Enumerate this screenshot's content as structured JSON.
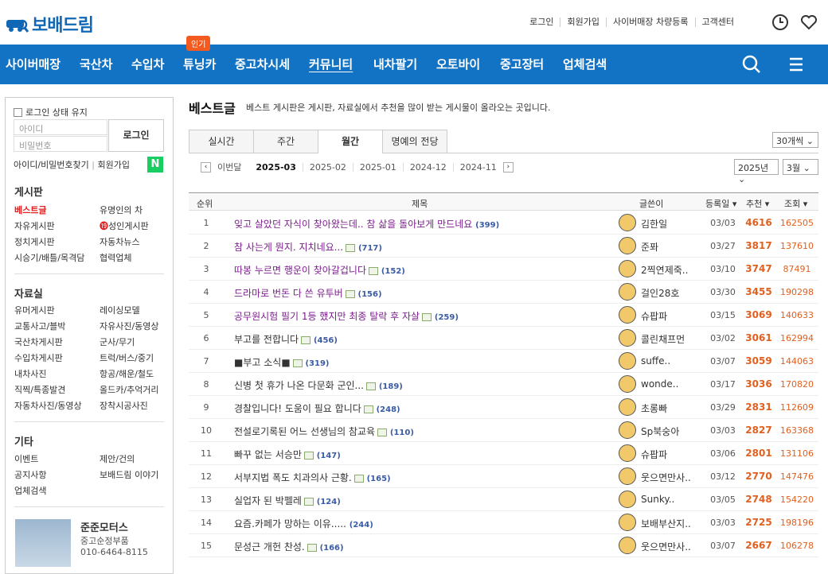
{
  "brand": {
    "logo_text": "보배드림",
    "accent": "#1273c4",
    "badge_color": "#f25a1f"
  },
  "top_links": [
    "로그인",
    "회원가입",
    "사이버매장 차량등록",
    "고객센터"
  ],
  "top_icons": [
    "clock-icon",
    "heart-icon"
  ],
  "nav": {
    "items": [
      "사이버매장",
      "국산차",
      "수입차",
      "튜닝카",
      "중고차시세",
      "커뮤니티",
      "내차팔기",
      "오토바이",
      "중고장터",
      "업체검색"
    ],
    "active": "커뮤니티",
    "hot_badge": "인기"
  },
  "sidebar": {
    "keep_login": "로그인 상태 유지",
    "id_placeholder": "아이디",
    "pw_placeholder": "비밀번호",
    "login_button": "로그인",
    "find_link": "아이디/비밀번호찾기",
    "join_link": "회원가입",
    "naver_label": "N",
    "sections": [
      {
        "title": "게시판",
        "items": [
          "베스트글",
          "유명인의 차",
          "자유게시판",
          "성인게시판",
          "정치게시판",
          "자동차뉴스",
          "시승기/배틀/목격담",
          "협력업체"
        ]
      },
      {
        "title": "자료실",
        "items": [
          "유머게시판",
          "레이싱모델",
          "교통사고/블박",
          "자유사진/동영상",
          "국산차게시판",
          "군사/무기",
          "수입차게시판",
          "트럭/버스/중기",
          "내차사진",
          "항공/해운/철도",
          "직찍/특종발견",
          "올드카/추억거리",
          "자동차사진/동영상",
          "장착시공사진"
        ]
      },
      {
        "title": "기타",
        "items": [
          "이벤트",
          "제안/건의",
          "공지사항",
          "보배드림 이야기",
          "업체검색"
        ]
      }
    ],
    "banner": {
      "title": "준준모터스",
      "sub": "중고순정부품",
      "phone": "010-6464-8115"
    }
  },
  "main": {
    "title": "베스트글",
    "desc": "베스트 게시판은 게시판, 자료실에서 추천을 많이 받는 게시물이 올라오는 곳입니다.",
    "tabs": [
      "실시간",
      "주간",
      "월간",
      "명예의 전당"
    ],
    "active_tab": "월간",
    "per_page": "30개씩",
    "prev_label": "이번달",
    "months": [
      "2025-03",
      "2025-02",
      "2025-01",
      "2024-12",
      "2024-11"
    ],
    "year_select": "2025년",
    "month_select": "3월",
    "columns": [
      "순위",
      "제목",
      "글쓴이",
      "등록일",
      "추천",
      "조회"
    ]
  },
  "posts": [
    {
      "no": "1",
      "title": "잊고 살았던 자식이 찾아왔는데.. 참 삶을 돌아보게 만드네요",
      "img": false,
      "cmt": "(399)",
      "writer": "김한일",
      "date": "03/03",
      "rec": "4616",
      "views": "162505",
      "visited": true
    },
    {
      "no": "2",
      "title": "참 사는게 뭔지. 지치네요...",
      "img": true,
      "cmt": "(717)",
      "writer": "준퐈",
      "date": "03/27",
      "rec": "3817",
      "views": "137610",
      "visited": true
    },
    {
      "no": "3",
      "title": "따봉 누르면 행운이 찾아갈겁니다",
      "img": true,
      "cmt": "(152)",
      "writer": "2찍연제죽..",
      "date": "03/10",
      "rec": "3747",
      "views": "87491",
      "visited": true
    },
    {
      "no": "4",
      "title": "드라마로 번돈 다 쓴 유투버",
      "img": true,
      "cmt": "(156)",
      "writer": "걸인28호",
      "date": "03/30",
      "rec": "3455",
      "views": "190298",
      "visited": true
    },
    {
      "no": "5",
      "title": "공무원시험 필기 1등 했지만 최종 탈락 후 자살",
      "img": true,
      "cmt": "(259)",
      "writer": "슈팝파",
      "date": "03/15",
      "rec": "3069",
      "views": "140633",
      "visited": true
    },
    {
      "no": "6",
      "title": "부고를 전합니다",
      "img": true,
      "cmt": "(456)",
      "writer": "콜린채프먼",
      "date": "03/02",
      "rec": "3061",
      "views": "162994",
      "visited": false
    },
    {
      "no": "7",
      "title": "■부고 소식■",
      "img": true,
      "cmt": "(319)",
      "writer": "suffe..",
      "date": "03/07",
      "rec": "3059",
      "views": "144063",
      "visited": false
    },
    {
      "no": "8",
      "title": "신병 첫 휴가 나온 다문화 군인...",
      "img": true,
      "cmt": "(189)",
      "writer": "wonde..",
      "date": "03/17",
      "rec": "3036",
      "views": "170820",
      "visited": false
    },
    {
      "no": "9",
      "title": "경찰입니다! 도움이 필요 합니다",
      "img": true,
      "cmt": "(248)",
      "writer": "초롱빠",
      "date": "03/29",
      "rec": "2831",
      "views": "112609",
      "visited": false
    },
    {
      "no": "10",
      "title": "전설로기록된 어느 선생님의 참교육",
      "img": true,
      "cmt": "(110)",
      "writer": "Sp북숭아",
      "date": "03/03",
      "rec": "2827",
      "views": "163368",
      "visited": false
    },
    {
      "no": "11",
      "title": "빠꾸 없는 서승만",
      "img": true,
      "cmt": "(147)",
      "writer": "슈팝파",
      "date": "03/06",
      "rec": "2801",
      "views": "131106",
      "visited": false
    },
    {
      "no": "12",
      "title": "서부지법 폭도 치과의사 근황.",
      "img": true,
      "cmt": "(165)",
      "writer": "웃으면만사..",
      "date": "03/12",
      "rec": "2770",
      "views": "147476",
      "visited": false
    },
    {
      "no": "13",
      "title": "실업자 된 박펠레",
      "img": true,
      "cmt": "(124)",
      "writer": "Sunky..",
      "date": "03/05",
      "rec": "2748",
      "views": "154220",
      "visited": false
    },
    {
      "no": "14",
      "title": "요즘.카페가 망하는 이유.....",
      "img": false,
      "cmt": "(244)",
      "writer": "보배부산지..",
      "date": "03/03",
      "rec": "2725",
      "views": "198196",
      "visited": false
    },
    {
      "no": "15",
      "title": "문성근 개헌 찬성.",
      "img": true,
      "cmt": "(166)",
      "writer": "웃으면만사..",
      "date": "03/07",
      "rec": "2667",
      "views": "106278",
      "visited": false
    }
  ]
}
